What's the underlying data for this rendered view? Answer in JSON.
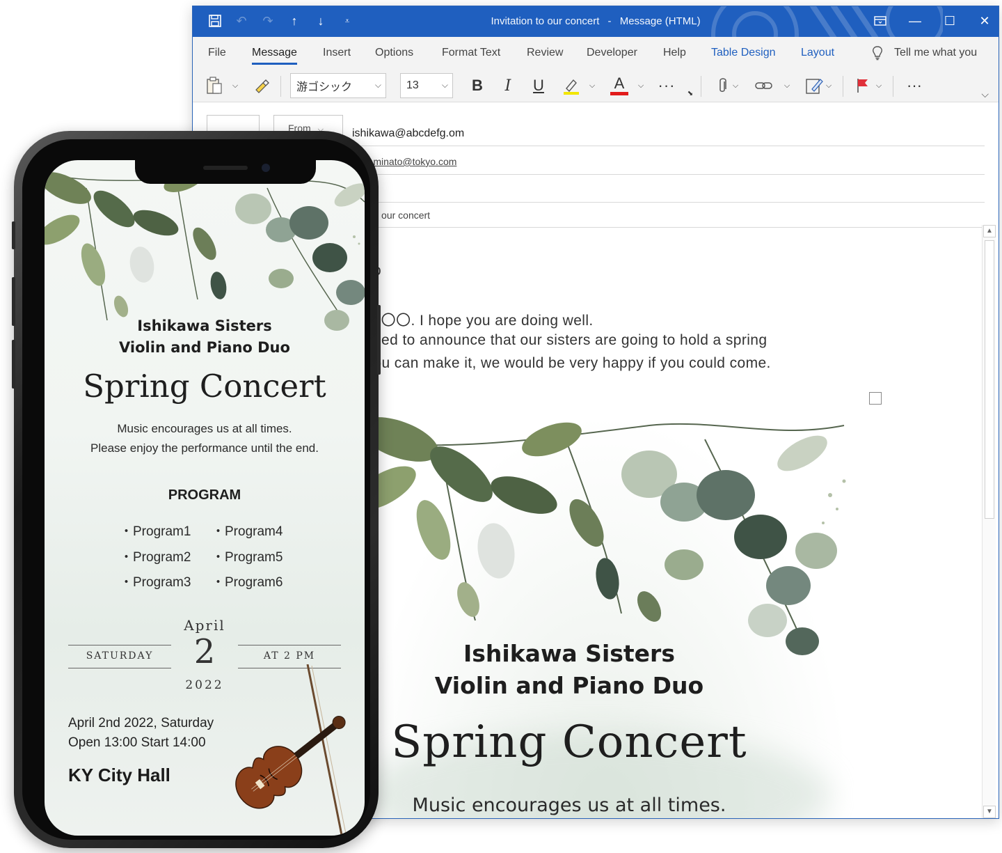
{
  "window": {
    "title": "Invitation to our concert",
    "title_sep": "-",
    "title_mode": "Message (HTML)"
  },
  "menu": {
    "tabs": [
      {
        "label": "File"
      },
      {
        "label": "Message"
      },
      {
        "label": "Insert"
      },
      {
        "label": "Options"
      },
      {
        "label": "Format Text"
      },
      {
        "label": "Review"
      },
      {
        "label": "Developer"
      },
      {
        "label": "Help"
      },
      {
        "label": "Table Design"
      },
      {
        "label": "Layout"
      }
    ],
    "active_tab": "Message",
    "tell_me": "Tell me what you"
  },
  "ribbon": {
    "font_name": "游ゴシック",
    "font_size": "13",
    "bold": "B",
    "italic": "I",
    "underline": "U",
    "font_color": "A",
    "more": "···"
  },
  "header": {
    "from_label": "From",
    "from_address": "ishikawa@abcdefg.om",
    "to_address": "ako_minato@tokyo.com",
    "subject_partial": "tion to our concert"
  },
  "email_body": {
    "greeting": "ako",
    "line1": "; is  〇〇. I hope you are doing well.",
    "line2": "eased to announce that our sisters are going to hold a spring",
    "line3": "f you can make it, we would be very happy if you could come."
  },
  "invitation": {
    "artist_line1": "Ishikawa Sisters",
    "artist_line2": "Violin and Piano Duo",
    "title": "Spring Concert",
    "message_line1": "Music encourages us at all times.",
    "message_line2": "Please enjoy the performance until the end.",
    "program_heading": "PROGRAM",
    "programs": [
      "・Program1",
      "・Program2",
      "・Program3",
      "・Program4",
      "・Program5",
      "・Program6"
    ],
    "month": "April",
    "day": "2",
    "year": "2022",
    "weekday": "SATURDAY",
    "time": "AT 2 PM",
    "date_line": "April 2nd 2022, Saturday",
    "hours_line": "Open 13:00    Start 14:00",
    "venue": "KY City Hall"
  },
  "colors": {
    "titlebar": "#1f5fbf",
    "accent_tab": "#1f5fbf",
    "leaf_dark": "#3f5346",
    "leaf_olive": "#7d8f5e",
    "leaf_sage": "#a9b8a2"
  }
}
